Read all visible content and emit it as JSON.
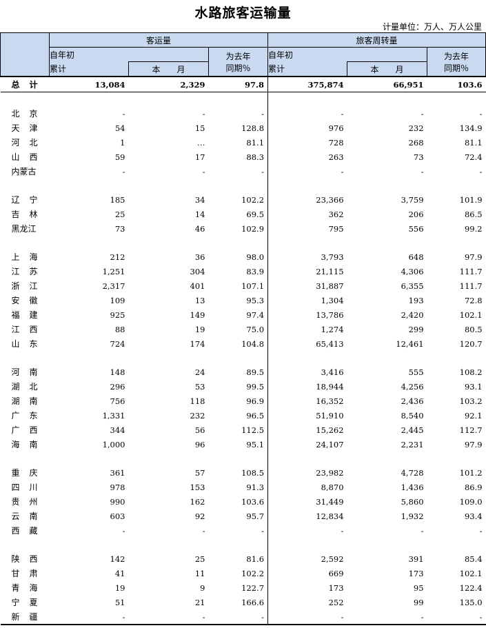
{
  "title": "水路旅客运输量",
  "unit": "计量单位：万人、万人公里",
  "headers": {
    "group1": "客运量",
    "group2": "旅客周转量",
    "ytd_top": "自年初",
    "ytd_bottom": "累计",
    "month": "本　　月",
    "yoy_top": "为去年",
    "yoy_bottom": "同期％"
  },
  "total": {
    "name": "总计",
    "v": [
      "13,084",
      "2,329",
      "97.8",
      "375,874",
      "66,951",
      "103.6"
    ]
  },
  "groups": [
    [
      {
        "name": "北京",
        "v": [
          "-",
          "-",
          "-",
          "-",
          "-",
          "-"
        ]
      },
      {
        "name": "天津",
        "v": [
          "54",
          "15",
          "128.8",
          "976",
          "232",
          "134.9"
        ]
      },
      {
        "name": "河北",
        "v": [
          "1",
          "…",
          "81.1",
          "728",
          "268",
          "81.1"
        ]
      },
      {
        "name": "山西",
        "v": [
          "59",
          "17",
          "88.3",
          "263",
          "73",
          "72.4"
        ]
      },
      {
        "name": "内蒙古",
        "v": [
          "-",
          "-",
          "-",
          "-",
          "-",
          "-"
        ]
      }
    ],
    [
      {
        "name": "辽宁",
        "v": [
          "185",
          "34",
          "102.2",
          "23,366",
          "3,759",
          "101.9"
        ]
      },
      {
        "name": "吉林",
        "v": [
          "25",
          "14",
          "69.5",
          "362",
          "206",
          "86.5"
        ]
      },
      {
        "name": "黑龙江",
        "v": [
          "73",
          "46",
          "102.9",
          "795",
          "556",
          "99.2"
        ]
      }
    ],
    [
      {
        "name": "上海",
        "v": [
          "212",
          "36",
          "98.0",
          "3,793",
          "648",
          "97.9"
        ]
      },
      {
        "name": "江苏",
        "v": [
          "1,251",
          "304",
          "83.9",
          "21,115",
          "4,306",
          "111.7"
        ]
      },
      {
        "name": "浙江",
        "v": [
          "2,317",
          "401",
          "107.1",
          "31,887",
          "6,355",
          "111.7"
        ]
      },
      {
        "name": "安徽",
        "v": [
          "109",
          "13",
          "95.3",
          "1,304",
          "193",
          "72.8"
        ]
      },
      {
        "name": "福建",
        "v": [
          "925",
          "149",
          "97.4",
          "13,786",
          "2,420",
          "102.1"
        ]
      },
      {
        "name": "江西",
        "v": [
          "88",
          "19",
          "75.0",
          "1,274",
          "299",
          "80.5"
        ]
      },
      {
        "name": "山东",
        "v": [
          "724",
          "174",
          "104.8",
          "65,413",
          "12,461",
          "120.7"
        ]
      }
    ],
    [
      {
        "name": "河南",
        "v": [
          "148",
          "24",
          "89.5",
          "3,416",
          "555",
          "108.2"
        ]
      },
      {
        "name": "湖北",
        "v": [
          "296",
          "53",
          "99.5",
          "18,944",
          "4,256",
          "93.1"
        ]
      },
      {
        "name": "湖南",
        "v": [
          "756",
          "118",
          "96.9",
          "16,352",
          "2,436",
          "103.2"
        ]
      },
      {
        "name": "广东",
        "v": [
          "1,331",
          "232",
          "96.5",
          "51,910",
          "8,540",
          "92.1"
        ]
      },
      {
        "name": "广西",
        "v": [
          "344",
          "56",
          "112.5",
          "15,262",
          "2,445",
          "112.7"
        ]
      },
      {
        "name": "海南",
        "v": [
          "1,000",
          "96",
          "95.1",
          "24,107",
          "2,231",
          "97.9"
        ]
      }
    ],
    [
      {
        "name": "重庆",
        "v": [
          "361",
          "57",
          "108.5",
          "23,982",
          "4,728",
          "101.2"
        ]
      },
      {
        "name": "四川",
        "v": [
          "978",
          "153",
          "91.3",
          "8,870",
          "1,436",
          "86.9"
        ]
      },
      {
        "name": "贵州",
        "v": [
          "990",
          "162",
          "103.6",
          "31,449",
          "5,860",
          "109.0"
        ]
      },
      {
        "name": "云南",
        "v": [
          "603",
          "92",
          "95.7",
          "12,834",
          "1,932",
          "93.4"
        ]
      },
      {
        "name": "西藏",
        "v": [
          "-",
          "-",
          "-",
          "-",
          "-",
          "-"
        ]
      }
    ],
    [
      {
        "name": "陕西",
        "v": [
          "142",
          "25",
          "81.6",
          "2,592",
          "391",
          "85.4"
        ]
      },
      {
        "name": "甘肃",
        "v": [
          "41",
          "11",
          "102.2",
          "669",
          "173",
          "102.1"
        ]
      },
      {
        "name": "青海",
        "v": [
          "19",
          "9",
          "122.7",
          "173",
          "95",
          "122.4"
        ]
      },
      {
        "name": "宁夏",
        "v": [
          "51",
          "21",
          "166.6",
          "252",
          "99",
          "135.0"
        ]
      },
      {
        "name": "新疆",
        "v": [
          "-",
          "-",
          "-",
          "-",
          "-",
          "-"
        ]
      }
    ]
  ]
}
